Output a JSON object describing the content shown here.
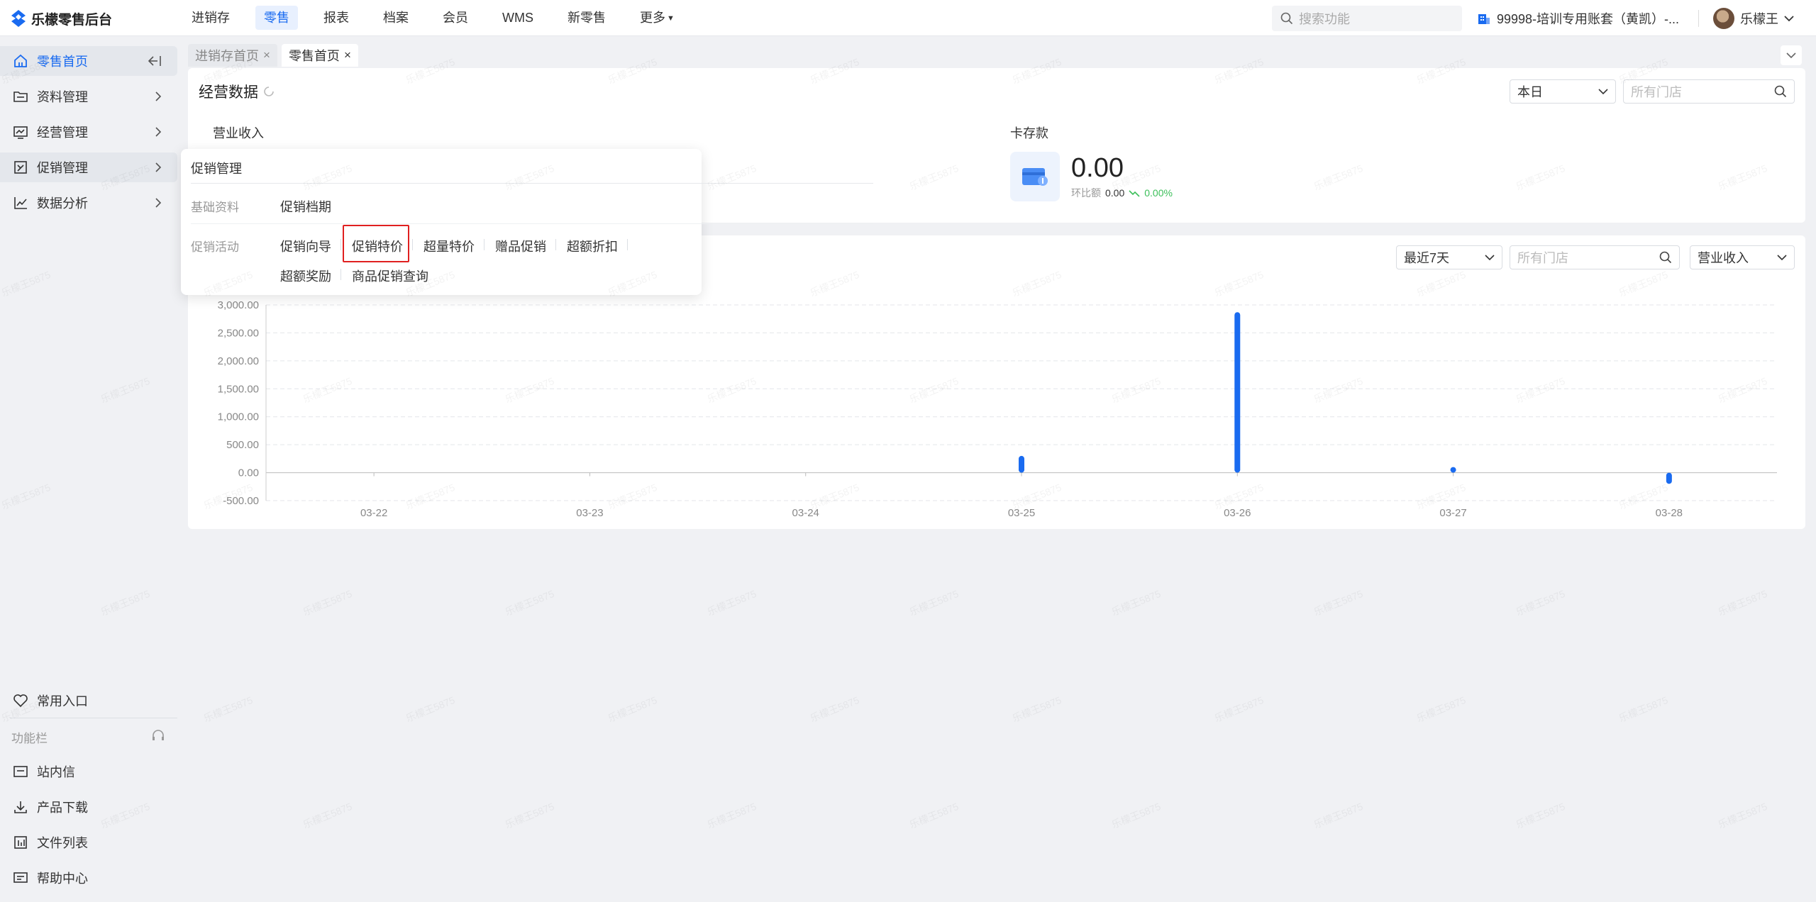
{
  "app": {
    "title": "乐檬零售后台"
  },
  "topnav": {
    "items": [
      "进销存",
      "零售",
      "报表",
      "档案",
      "会员",
      "WMS",
      "新零售",
      "更多"
    ],
    "active_index": 1,
    "search_placeholder": "搜索功能",
    "account": "99998-培训专用账套（黄凯）-...",
    "user": "乐檬王"
  },
  "sidebar": {
    "items": [
      {
        "label": "零售首页",
        "icon": "home-icon"
      },
      {
        "label": "资料管理",
        "icon": "folder-icon"
      },
      {
        "label": "经营管理",
        "icon": "monitor-icon"
      },
      {
        "label": "促销管理",
        "icon": "coupon-icon"
      },
      {
        "label": "数据分析",
        "icon": "chart-line-icon"
      }
    ],
    "bottom_items": [
      {
        "label": "常用入口",
        "icon": "heart-icon"
      },
      {
        "label": "站内信",
        "icon": "message-icon"
      },
      {
        "label": "产品下载",
        "icon": "download-icon"
      },
      {
        "label": "文件列表",
        "icon": "file-list-icon"
      },
      {
        "label": "帮助中心",
        "icon": "help-icon"
      }
    ],
    "section_label": "功能栏"
  },
  "tabs": [
    {
      "label": "进销存首页",
      "active": false
    },
    {
      "label": "零售首页",
      "active": true
    }
  ],
  "ops": {
    "title": "经营数据",
    "period": "本日",
    "store_placeholder": "所有门店",
    "revenue_label": "营业收入",
    "card_label": "卡存款",
    "card_value": "0.00",
    "ratio_label": "环比额",
    "ratio_value": "0.00",
    "ratio_pct": "0.00%"
  },
  "chart_filters": {
    "range": "最近7天",
    "store_placeholder": "所有门店",
    "metric": "营业收入"
  },
  "popup": {
    "title": "促销管理",
    "rows": [
      {
        "label": "基础资料",
        "links": [
          "促销档期"
        ]
      },
      {
        "label": "促销活动",
        "links": [
          "促销向导",
          "促销特价",
          "超量特价",
          "赠品促销",
          "超额折扣",
          "超额奖励",
          "商品促销查询"
        ]
      }
    ],
    "highlighted": "促销特价"
  },
  "watermark": "乐檬王5875",
  "chart_data": {
    "type": "bar",
    "categories": [
      "03-22",
      "03-23",
      "03-24",
      "03-25",
      "03-26",
      "03-27",
      "03-28"
    ],
    "series": [
      {
        "values": [
          0,
          0,
          0,
          300,
          2870,
          60,
          -200
        ]
      }
    ],
    "yticks": [
      "3,000.00",
      "2,500.00",
      "2,000.00",
      "1,500.00",
      "1,000.00",
      "500.00",
      "0.00",
      "-500.00"
    ],
    "ylim": [
      -500,
      3000
    ],
    "grid": true,
    "color": "#1a6bf0"
  }
}
